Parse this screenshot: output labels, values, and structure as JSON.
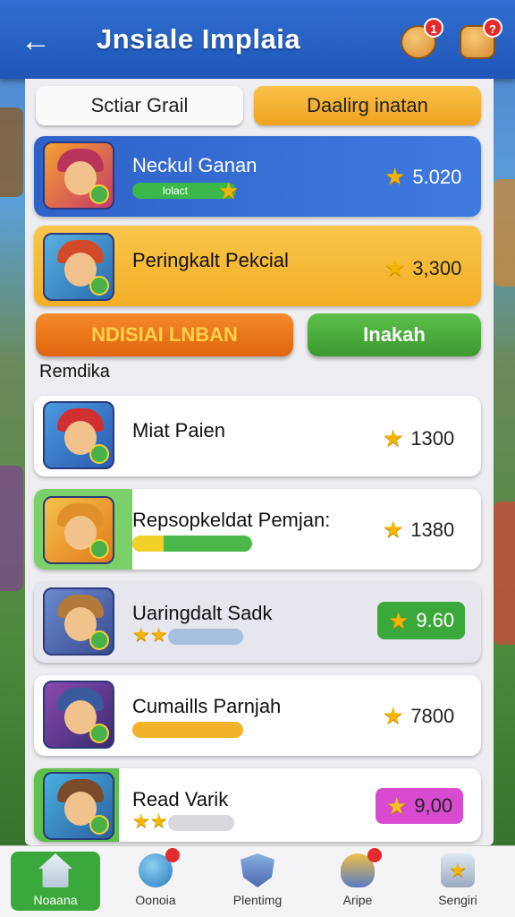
{
  "header": {
    "title": "Jnsiale Implaia",
    "badge_chat": "1",
    "badge_gift": "?"
  },
  "tabs": {
    "left": "Sctiar Grail",
    "right": "Daalirg inatan"
  },
  "top_cards": [
    {
      "name": "Neckul Ganan",
      "tag": "lolact",
      "score": "5.020"
    },
    {
      "name": "Peringkalt Pekcial",
      "score": "3,300"
    }
  ],
  "actions": {
    "primary": "NDISIAI LNBAN",
    "secondary": "Inakah"
  },
  "section_label": "Remdika",
  "list": [
    {
      "name": "Miat Paien",
      "score": "1300"
    },
    {
      "name": "Repsopkeldat Pemjan:",
      "score": "1380"
    },
    {
      "name": "Uaringdalt Sadk",
      "score": "9.60"
    },
    {
      "name": "Cumaills Parnjah",
      "score": "7800"
    },
    {
      "name": "Read Varik",
      "score": "9,00"
    }
  ],
  "nav": [
    {
      "label": "Noaana"
    },
    {
      "label": "Oonoia"
    },
    {
      "label": "Plentimg"
    },
    {
      "label": "Aripe"
    },
    {
      "label": "Sengiri"
    }
  ],
  "colors": {
    "header": "#2f6fd0",
    "card_blue": "#2f6fd0",
    "card_yellow": "#f6b92e",
    "orange": "#f07a1a",
    "green": "#4aaa3a",
    "gold": "#f4b400"
  }
}
